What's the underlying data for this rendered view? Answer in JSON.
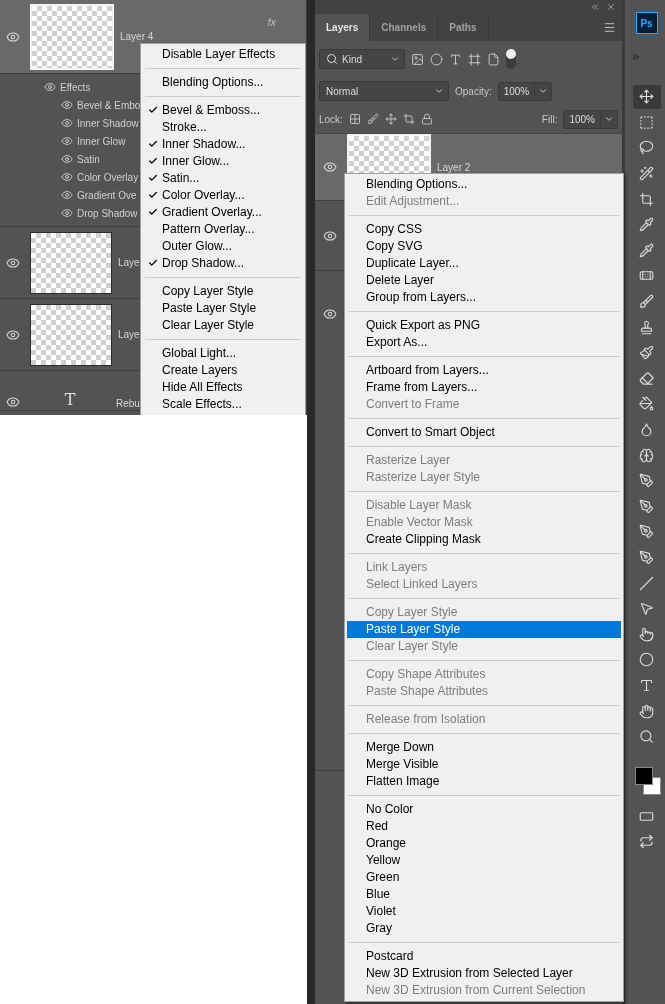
{
  "left_panel": {
    "layers": [
      {
        "name": "Layer 4",
        "kind": "image",
        "selected": true,
        "fx": "fx",
        "effects_label": "Effects",
        "effects": [
          "Bevel & Embo",
          "Inner Shadow",
          "Inner Glow",
          "Satin",
          "Color Overlay",
          "Gradient Ove",
          "Drop Shadow"
        ]
      },
      {
        "name": "Laye",
        "kind": "image",
        "selected": false
      },
      {
        "name": "Laye",
        "kind": "image",
        "selected": false
      },
      {
        "name": "Rebu",
        "kind": "text",
        "glyph": "T",
        "selected": false
      }
    ],
    "menu": {
      "groups": [
        [
          {
            "label": "Disable Layer Effects",
            "checked": false
          }
        ],
        [
          {
            "label": "Blending Options...",
            "checked": false
          }
        ],
        [
          {
            "label": "Bevel & Emboss...",
            "checked": true
          },
          {
            "label": "Stroke...",
            "checked": false
          },
          {
            "label": "Inner Shadow...",
            "checked": true
          },
          {
            "label": "Inner Glow...",
            "checked": true
          },
          {
            "label": "Satin...",
            "checked": true
          },
          {
            "label": "Color Overlay...",
            "checked": true
          },
          {
            "label": "Gradient Overlay...",
            "checked": true
          },
          {
            "label": "Pattern Overlay...",
            "checked": false
          },
          {
            "label": "Outer Glow...",
            "checked": false
          },
          {
            "label": "Drop Shadow...",
            "checked": true
          }
        ],
        [
          {
            "label": "Copy Layer Style",
            "checked": false
          },
          {
            "label": "Paste Layer Style",
            "checked": false
          },
          {
            "label": "Clear Layer Style",
            "checked": false
          }
        ],
        [
          {
            "label": "Global Light...",
            "checked": false
          },
          {
            "label": "Create Layers",
            "checked": false
          },
          {
            "label": "Hide All Effects",
            "checked": false
          },
          {
            "label": "Scale Effects...",
            "checked": false
          }
        ]
      ]
    }
  },
  "layers_panel": {
    "tabs": [
      {
        "label": "Layers",
        "selected": true
      },
      {
        "label": "Channels",
        "selected": false
      },
      {
        "label": "Paths",
        "selected": false
      }
    ],
    "filter": {
      "value": "Kind"
    },
    "blend_mode": {
      "value": "Normal"
    },
    "opacity": {
      "label": "Opacity:",
      "value": "100%"
    },
    "lock": {
      "label": "Lock:"
    },
    "fill": {
      "label": "Fill:",
      "value": "100%"
    },
    "layers": [
      {
        "name": "Layer 2",
        "selected": true
      },
      {
        "selected": false
      },
      {
        "selected": false
      }
    ],
    "menu": {
      "groups": [
        [
          {
            "label": "Blending Options...",
            "disabled": false,
            "selected": false
          },
          {
            "label": "Edit Adjustment...",
            "disabled": true,
            "selected": false
          }
        ],
        [
          {
            "label": "Copy CSS",
            "disabled": false,
            "selected": false
          },
          {
            "label": "Copy SVG",
            "disabled": false,
            "selected": false
          },
          {
            "label": "Duplicate Layer...",
            "disabled": false,
            "selected": false
          },
          {
            "label": "Delete Layer",
            "disabled": false,
            "selected": false
          },
          {
            "label": "Group from Layers...",
            "disabled": false,
            "selected": false
          }
        ],
        [
          {
            "label": "Quick Export as PNG",
            "disabled": false,
            "selected": false
          },
          {
            "label": "Export As...",
            "disabled": false,
            "selected": false
          }
        ],
        [
          {
            "label": "Artboard from Layers...",
            "disabled": false,
            "selected": false
          },
          {
            "label": "Frame from Layers...",
            "disabled": false,
            "selected": false
          },
          {
            "label": "Convert to Frame",
            "disabled": true,
            "selected": false
          }
        ],
        [
          {
            "label": "Convert to Smart Object",
            "disabled": false,
            "selected": false
          }
        ],
        [
          {
            "label": "Rasterize Layer",
            "disabled": true,
            "selected": false
          },
          {
            "label": "Rasterize Layer Style",
            "disabled": true,
            "selected": false
          }
        ],
        [
          {
            "label": "Disable Layer Mask",
            "disabled": true,
            "selected": false
          },
          {
            "label": "Enable Vector Mask",
            "disabled": true,
            "selected": false
          },
          {
            "label": "Create Clipping Mask",
            "disabled": false,
            "selected": false
          }
        ],
        [
          {
            "label": "Link Layers",
            "disabled": true,
            "selected": false
          },
          {
            "label": "Select Linked Layers",
            "disabled": true,
            "selected": false
          }
        ],
        [
          {
            "label": "Copy Layer Style",
            "disabled": true,
            "selected": false
          },
          {
            "label": "Paste Layer Style",
            "disabled": false,
            "selected": true
          },
          {
            "label": "Clear Layer Style",
            "disabled": true,
            "selected": false
          }
        ],
        [
          {
            "label": "Copy Shape Attributes",
            "disabled": true,
            "selected": false
          },
          {
            "label": "Paste Shape Attributes",
            "disabled": true,
            "selected": false
          }
        ],
        [
          {
            "label": "Release from Isolation",
            "disabled": true,
            "selected": false
          }
        ],
        [
          {
            "label": "Merge Down",
            "disabled": false,
            "selected": false
          },
          {
            "label": "Merge Visible",
            "disabled": false,
            "selected": false
          },
          {
            "label": "Flatten Image",
            "disabled": false,
            "selected": false
          }
        ],
        [
          {
            "label": "No Color",
            "disabled": false,
            "selected": false
          },
          {
            "label": "Red",
            "disabled": false,
            "selected": false
          },
          {
            "label": "Orange",
            "disabled": false,
            "selected": false
          },
          {
            "label": "Yellow",
            "disabled": false,
            "selected": false
          },
          {
            "label": "Green",
            "disabled": false,
            "selected": false
          },
          {
            "label": "Blue",
            "disabled": false,
            "selected": false
          },
          {
            "label": "Violet",
            "disabled": false,
            "selected": false
          },
          {
            "label": "Gray",
            "disabled": false,
            "selected": false
          }
        ],
        [
          {
            "label": "Postcard",
            "disabled": false,
            "selected": false
          },
          {
            "label": "New 3D Extrusion from Selected Layer",
            "disabled": false,
            "selected": false
          },
          {
            "label": "New 3D Extrusion from Current Selection",
            "disabled": true,
            "selected": false
          }
        ]
      ]
    }
  },
  "toolbar": {
    "app_badge": "Ps"
  }
}
